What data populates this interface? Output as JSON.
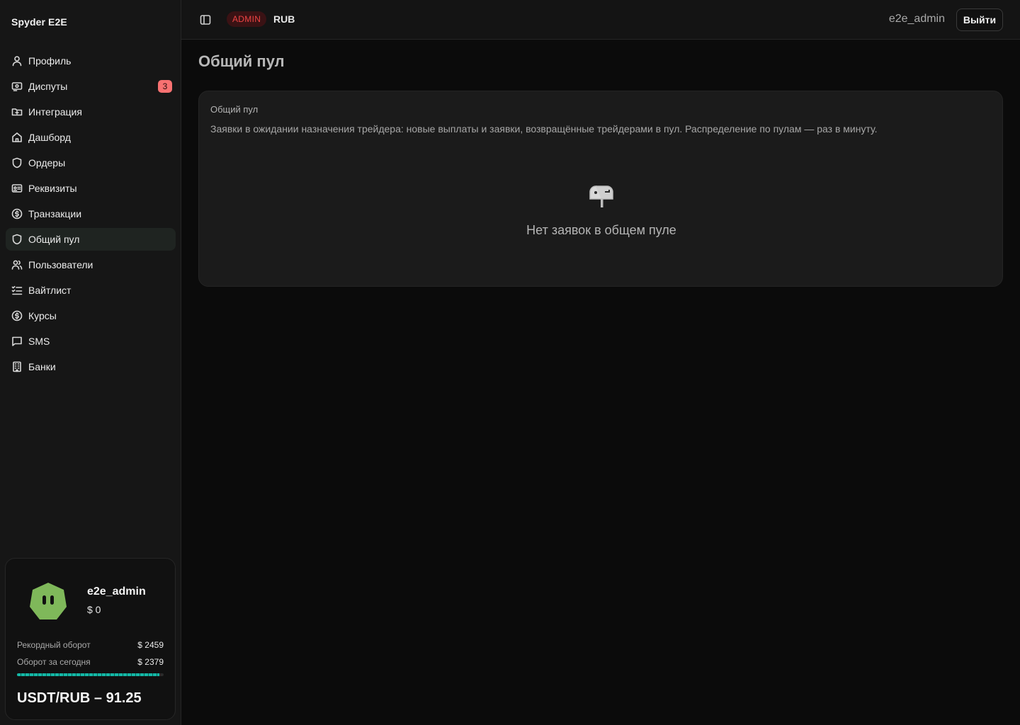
{
  "brand": "Spyder E2E",
  "sidebar": {
    "items": [
      {
        "label": "Профиль",
        "icon": "user-icon"
      },
      {
        "label": "Диспуты",
        "icon": "ticket-icon",
        "badge": "3"
      },
      {
        "label": "Интеграция",
        "icon": "folder-link-icon"
      },
      {
        "label": "Дашборд",
        "icon": "home-icon"
      },
      {
        "label": "Ордеры",
        "icon": "shield-icon"
      },
      {
        "label": "Реквизиты",
        "icon": "id-card-icon"
      },
      {
        "label": "Транзакции",
        "icon": "dollar-circle-icon"
      },
      {
        "label": "Общий пул",
        "icon": "shield-icon",
        "active": true
      },
      {
        "label": "Пользователи",
        "icon": "users-icon"
      },
      {
        "label": "Вайтлист",
        "icon": "checklist-icon"
      },
      {
        "label": "Курсы",
        "icon": "dollar-circle-icon"
      },
      {
        "label": "SMS",
        "icon": "message-icon"
      },
      {
        "label": "Банки",
        "icon": "building-icon"
      }
    ]
  },
  "profile_card": {
    "name": "e2e_admin",
    "balance": "$ 0",
    "record_label": "Рекордный оборот",
    "record_value": "$ 2459",
    "today_label": "Оборот за сегодня",
    "today_value": "$ 2379",
    "today_progress_fraction": 0.97,
    "rate": "USDT/RUB – 91.25"
  },
  "topbar": {
    "role": "ADMIN",
    "currency": "RUB",
    "username": "e2e_admin",
    "logout_label": "Выйти"
  },
  "main": {
    "title": "Общий пул",
    "panel_title": "Общий пул",
    "panel_description": "Заявки в ожидании назначения трейдера: новые выплаты и заявки, возвращённые трейдерами в пул. Распределение по пулам — раз в минуту.",
    "empty_text": "Нет заявок в общем пуле"
  },
  "colors": {
    "accent_teal": "#14b8a6",
    "badge_red": "#f87171",
    "admin_red": "#ef4444",
    "avatar_green": "#7fb85a"
  }
}
